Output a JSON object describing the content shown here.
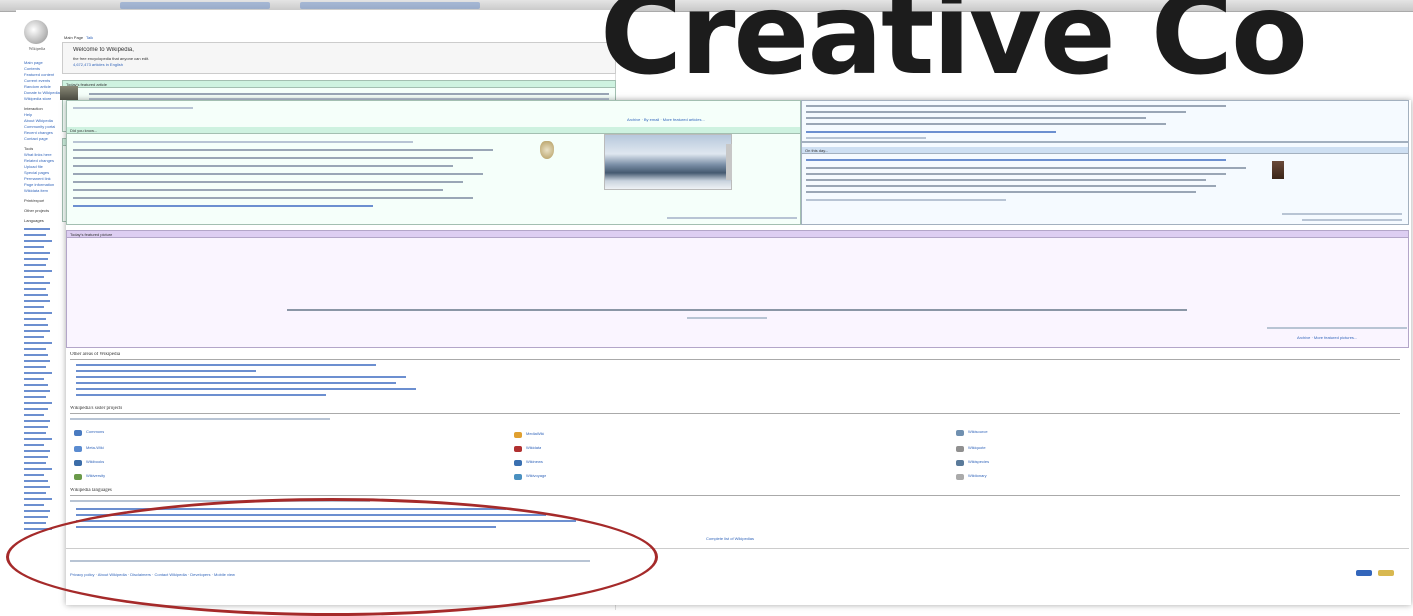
{
  "big_title": "Creative Co",
  "logo": {
    "name": "Wikipedia",
    "tagline": "The Free Encyclopedia"
  },
  "tabs": [
    "Main Page",
    "Talk"
  ],
  "page1": {
    "welcome": "Welcome to Wikipedia,",
    "subtitle": "the free encyclopedia that anyone can edit.",
    "articles": "4,672,473 articles in English",
    "featured_head": "Today's featured article",
    "dyk_head": "Did you know...",
    "recently_featured": "Recently featured:",
    "archive": "Archive · By email · More featured articles..."
  },
  "sidebar": [
    "Main page",
    "Contents",
    "Featured content",
    "Current events",
    "Random article",
    "Donate to Wikipedia",
    "Wikipedia store",
    "Interaction",
    "Help",
    "About Wikipedia",
    "Community portal",
    "Recent changes",
    "Contact page",
    "Tools",
    "What links here",
    "Related changes",
    "Upload file",
    "Special pages",
    "Permanent link",
    "Page information",
    "Wikidata item",
    "Print/export",
    "Other projects",
    "Languages"
  ],
  "page2": {
    "in_the_news_head": "In the news",
    "on_this_day_head": "On this day...",
    "potd_head": "Today's featured picture",
    "other_areas_title": "Other areas of Wikipedia",
    "sister_title": "Wikipedia's sister projects",
    "languages_title": "Wikipedia languages",
    "archive": "Archive · More featured pictures...",
    "complete_list": "Complete list of Wikipedias",
    "sister_projects": [
      "Commons",
      "MediaWiki",
      "Meta-Wiki",
      "Wikibooks",
      "Wikidata",
      "Wikinews",
      "Wikiquote",
      "Wikisource",
      "Wikispecies",
      "Wikiversity",
      "Wikivoyage",
      "Wiktionary"
    ],
    "footer_links": "Privacy policy · About Wikipedia · Disclaimers · Contact Wikipedia · Developers · Mobile view"
  },
  "colors": {
    "annotation": "#a52a2a",
    "link": "#3366bb"
  }
}
